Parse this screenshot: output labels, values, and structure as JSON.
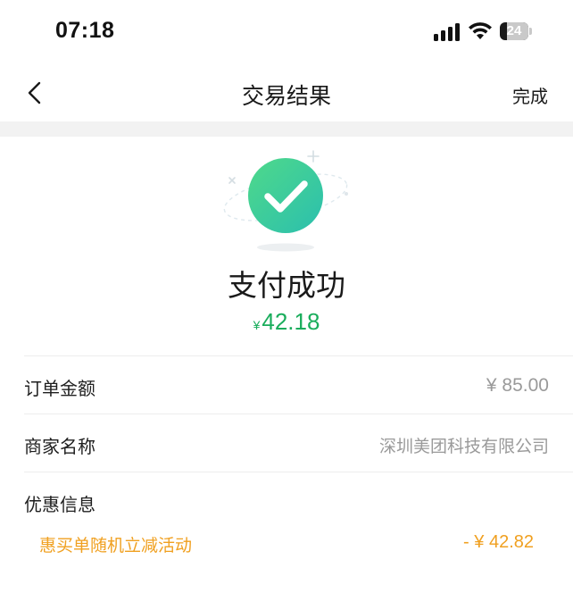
{
  "status_bar": {
    "time": "07:18",
    "battery_level": "24",
    "battery_fraction": 0.24
  },
  "nav": {
    "title": "交易结果",
    "done_label": "完成",
    "back_icon": "chevron-left-icon"
  },
  "result": {
    "icon": "success-check-icon",
    "title": "支付成功",
    "currency": "¥",
    "amount": "42.18"
  },
  "details": {
    "order_amount_label": "订单金额",
    "order_amount_value": "¥ 85.00",
    "merchant_label": "商家名称",
    "merchant_value": "深圳美团科技有限公司",
    "discount_label": "优惠信息",
    "discount_name": "惠买单随机立减活动",
    "discount_value": "- ¥ 42.82"
  },
  "colors": {
    "success_green": "#1aad5c",
    "discount_orange": "#f0a020",
    "check_gradient_start": "#4fd98a",
    "check_gradient_end": "#2bbfae"
  }
}
